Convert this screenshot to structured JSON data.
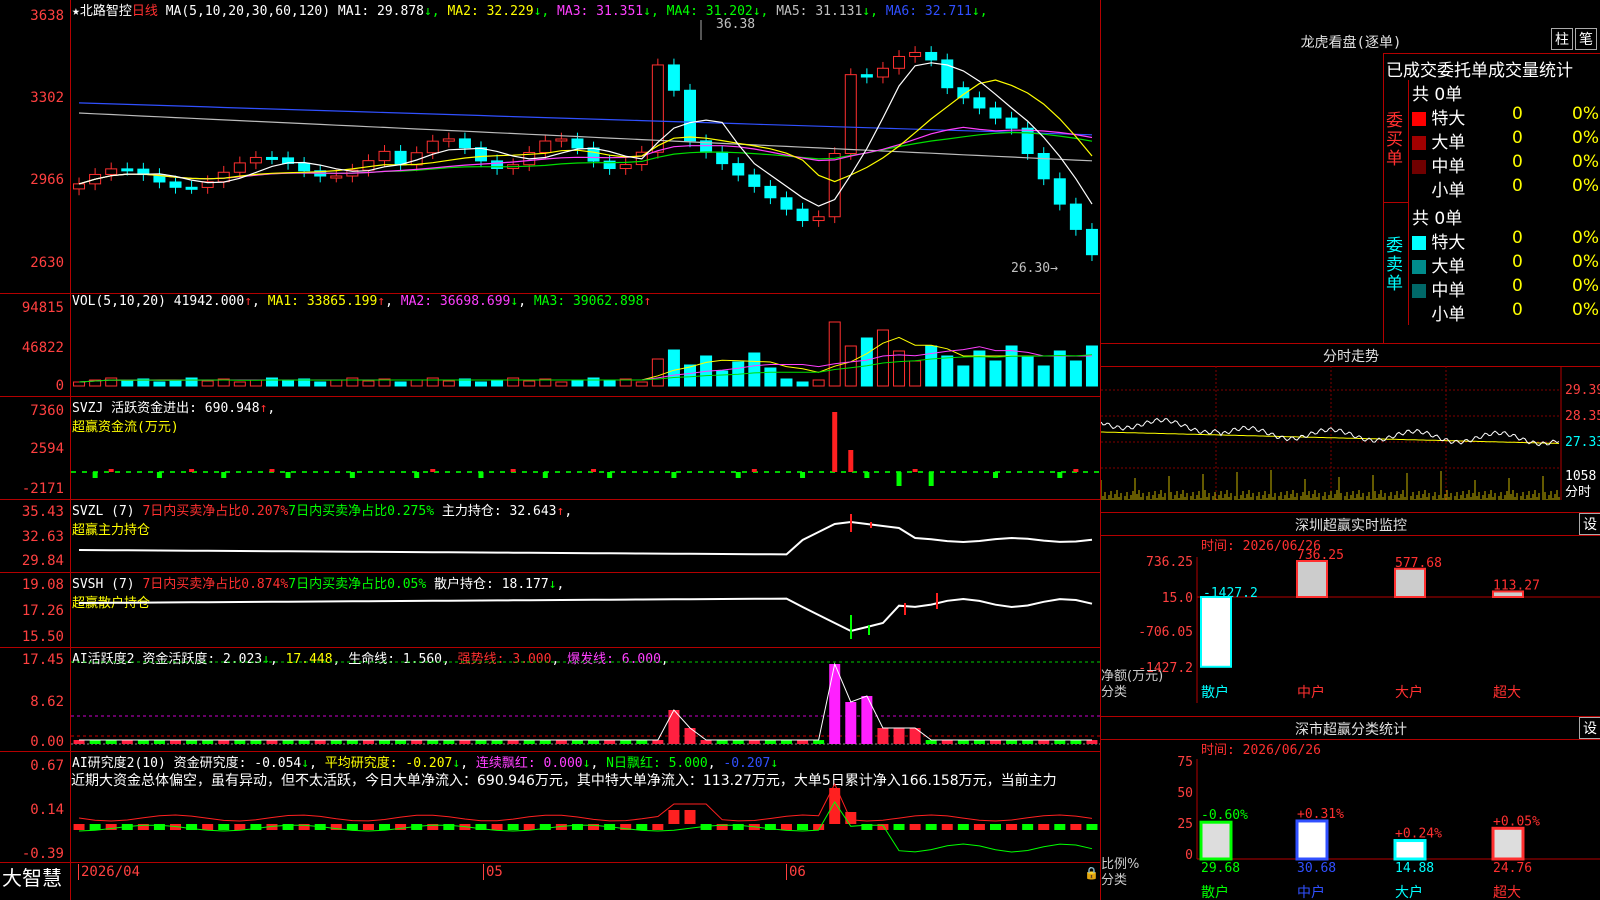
{
  "app_name": "大智慧",
  "stock": {
    "star": "★",
    "name": "北路智控",
    "period": "日线"
  },
  "price_pane": {
    "ma_label": "MA(5,10,20,30,60,120)",
    "ma": [
      {
        "name": "MA1",
        "value": "29.878",
        "arrow": "↓",
        "color": "#ffffff"
      },
      {
        "name": "MA2",
        "value": "32.229",
        "arrow": "↓",
        "color": "#ffff00"
      },
      {
        "name": "MA3",
        "value": "31.351",
        "arrow": "↓",
        "color": "#ff40ff"
      },
      {
        "name": "MA4",
        "value": "31.202",
        "arrow": "↓",
        "color": "#00ff00"
      },
      {
        "name": "MA5",
        "value": "31.131",
        "arrow": "↓",
        "color": "#c0c0c0"
      },
      {
        "name": "MA6",
        "value": "32.711",
        "arrow": "↓",
        "color": "#3050ff"
      }
    ],
    "y_labels": [
      "3638",
      "3302",
      "2966",
      "2630"
    ],
    "high_label": "36.38",
    "low_label": "26.30→"
  },
  "vol_pane": {
    "label": "VOL(5,10,20)",
    "value": "41942.000",
    "ma": [
      {
        "name": "MA1",
        "value": "33865.199",
        "arrow": "↑"
      },
      {
        "name": "MA2",
        "value": "36698.699",
        "arrow": "↓"
      },
      {
        "name": "MA3",
        "value": "39062.898",
        "arrow": "↑"
      }
    ],
    "y_labels": [
      "94815",
      "46822",
      "0"
    ]
  },
  "svzj_pane": {
    "line1": "SVZJ  活跃资金进出: 690.948",
    "line2": "超赢资金流(万元)",
    "y_labels": [
      "7360",
      "2594",
      "-2171"
    ]
  },
  "svzl_pane": {
    "name": "SVZL (7)",
    "t1": "7日内买卖净占比0.207%",
    "t2": "7日内买卖净占比0.275%",
    "t3": "主力持仓: 32.643",
    "line2": "超赢主力持仓",
    "y_labels": [
      "35.43",
      "32.63",
      "29.84"
    ]
  },
  "svsh_pane": {
    "name": "SVSH (7)",
    "t1": "7日内买卖净占比0.874%",
    "t2": "7日内买卖净占比0.05%",
    "t3": "散户持仓: 18.177",
    "line2": "超赢散户持仓",
    "y_labels": [
      "19.08",
      "17.26",
      "15.50"
    ]
  },
  "ai1_pane": {
    "t1": "AI活跃度2",
    "t2": "资金活跃度: 2.023",
    "t3": "17.448",
    "t4": "生命线: 1.560",
    "t5": "强势线: 3.000",
    "t6": "爆发线: 6.000",
    "y_labels": [
      "17.45",
      "8.62",
      "0.00"
    ]
  },
  "ai2_pane": {
    "t1": "AI研究度2(10)",
    "t2": "资金研究度: -0.054",
    "t3": "平均研究度: -0.207",
    "t4": "连续飘红: 0.000",
    "t5": "N日飘红: 5.000",
    "t6": "-0.207",
    "note": "近期大资金总体偏空，虽有异动，但不太活跃，今日大单净流入：690.946万元，其中特大单净流入：113.27万元，大单5日累计净入166.158万元，当前主力",
    "y_labels": [
      "0.67",
      "0.14",
      "-0.39"
    ]
  },
  "x_axis": [
    "2026/04",
    "05",
    "06"
  ],
  "right": {
    "dragon_title": "龙虎看盘(逐单)",
    "tabs": [
      "柱",
      "笔"
    ],
    "stats_header": "已成交委托单成交量统计",
    "buy": {
      "side": "委买单",
      "total": "共 0单",
      "rows": [
        {
          "label": "特大",
          "vol": "0",
          "pct": "0%",
          "color": "#ff0000"
        },
        {
          "label": "大单",
          "vol": "0",
          "pct": "0%",
          "color": "#a00000"
        },
        {
          "label": "中单",
          "vol": "0",
          "pct": "0%",
          "color": "#700000"
        },
        {
          "label": "小单",
          "vol": "0",
          "pct": "0%",
          "color": "#000000"
        }
      ]
    },
    "sell": {
      "side": "委卖单",
      "total": "共 0单",
      "rows": [
        {
          "label": "特大",
          "vol": "0",
          "pct": "0%",
          "color": "#00ffff"
        },
        {
          "label": "大单",
          "vol": "0",
          "pct": "0%",
          "color": "#008c8c"
        },
        {
          "label": "中单",
          "vol": "0",
          "pct": "0%",
          "color": "#006868"
        },
        {
          "label": "小单",
          "vol": "0",
          "pct": "0%",
          "color": "#000000"
        }
      ]
    },
    "intraday_title": "分时走势",
    "intraday_labels": [
      "29.39",
      "28.35",
      "27.33",
      "1058",
      "分时"
    ],
    "monitor_title": "深圳超赢实时监控",
    "monitor_set": "设",
    "monitor_time": "时间: 2026/06/26",
    "monitor_y": [
      "736.25",
      "15.0",
      "-706.05",
      "-1427.2"
    ],
    "monitor_vals": [
      "-1427.2",
      "736.25",
      "577.68",
      "113.27"
    ],
    "monitor_left": [
      "净额(万元)",
      "分类"
    ],
    "cats": [
      "散户",
      "中户",
      "大户",
      "超大"
    ],
    "class_title": "深市超赢分类统计",
    "class_set": "设",
    "class_time": "时间: 2026/06/26",
    "class_y": [
      "75",
      "50",
      "25",
      "0"
    ],
    "class_pct": [
      "-0.60%",
      "+0.31%",
      "+0.24%",
      "+0.05%"
    ],
    "class_vals": [
      "29.68",
      "30.68",
      "14.88",
      "24.76"
    ],
    "class_left": [
      "比例%",
      "分类"
    ]
  }
}
